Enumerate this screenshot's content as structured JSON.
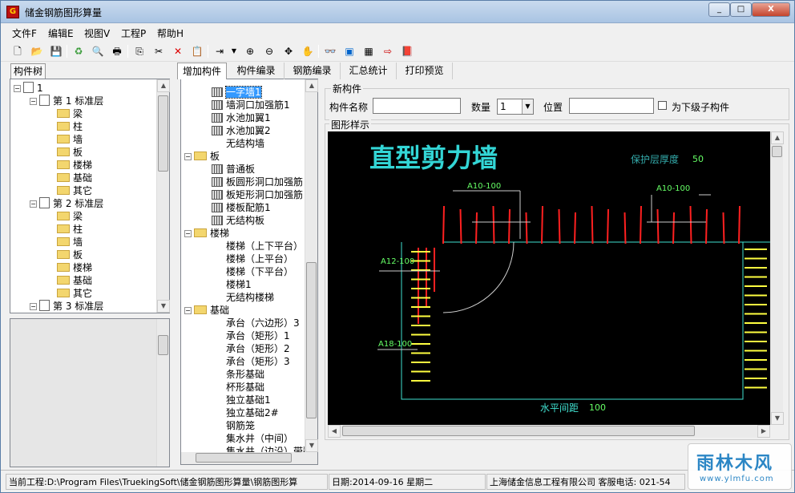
{
  "window": {
    "title": "储金钢筋图形算量",
    "min": "_",
    "max": "□",
    "close": "X"
  },
  "menu": [
    "文件F",
    "编辑E",
    "视图V",
    "工程P",
    "帮助H"
  ],
  "left_tab": "构件树",
  "left_tree": {
    "root": "1",
    "floors": [
      {
        "label": "第 1 标准层",
        "items": [
          "梁",
          "柱",
          "墙",
          "板",
          "楼梯",
          "基础",
          "其它"
        ]
      },
      {
        "label": "第 2 标准层",
        "items": [
          "梁",
          "柱",
          "墙",
          "板",
          "楼梯",
          "基础",
          "其它"
        ]
      },
      {
        "label": "第 3 标准层"
      }
    ]
  },
  "tabs": [
    "增加构件",
    "构件编录",
    "钢筋编录",
    "汇总统计",
    "打印预览"
  ],
  "comp_tree": {
    "wall_items": [
      "一字墙1",
      "墙洞口加强筋1",
      "水池加翼1",
      "水池加翼2",
      "无结构墙"
    ],
    "slab": {
      "label": "板",
      "items": [
        "普通板",
        "板圆形洞口加强筋",
        "板矩形洞口加强筋",
        "楼板配筋1",
        "无结构板"
      ]
    },
    "stair": {
      "label": "楼梯",
      "items": [
        "楼梯（上下平台）",
        "楼梯（上平台）",
        "楼梯（下平台）",
        "楼梯1",
        "无结构楼梯"
      ]
    },
    "found": {
      "label": "基础",
      "items": [
        "承台（六边形）3",
        "承台（矩形）1",
        "承台（矩形）2",
        "承台（矩形）3",
        "条形基础",
        "杯形基础",
        "独立基础1",
        "独立基础2#",
        "钢筋笼",
        "集水井（中间）",
        "集水井（边沿）带翻"
      ]
    }
  },
  "new_component": {
    "group_title": "新构件",
    "name_label": "构件名称",
    "name_value": "",
    "qty_label": "数量",
    "qty_value": "1",
    "pos_label": "位置",
    "pos_value": "",
    "sub_label": "为下级子构件"
  },
  "preview": {
    "group_title": "图形样示",
    "title": "直型剪力墙",
    "cover_label": "保护层厚度",
    "cover_value": "50",
    "labels": [
      "A10-100",
      "A10-100",
      "A12-100",
      "A18-100"
    ],
    "spacing_label": "水平间距",
    "spacing_value": "100",
    "colors": {
      "title": "#33d6d6",
      "annot": "#66ff66",
      "rebar_red": "#ff2020",
      "rebar_yellow": "#ffff40",
      "outline": "#40e0d0"
    }
  },
  "status": {
    "project": "当前工程:D:\\Program Files\\TruekingSoft\\储金钢筋图形算量\\钢筋图形算",
    "date": "日期:2014-09-16 星期二",
    "company": "上海储金信息工程有限公司 客服电话: 021-54"
  },
  "watermark": {
    "brand": "雨林木风",
    "url": "www.ylmfu.com"
  }
}
